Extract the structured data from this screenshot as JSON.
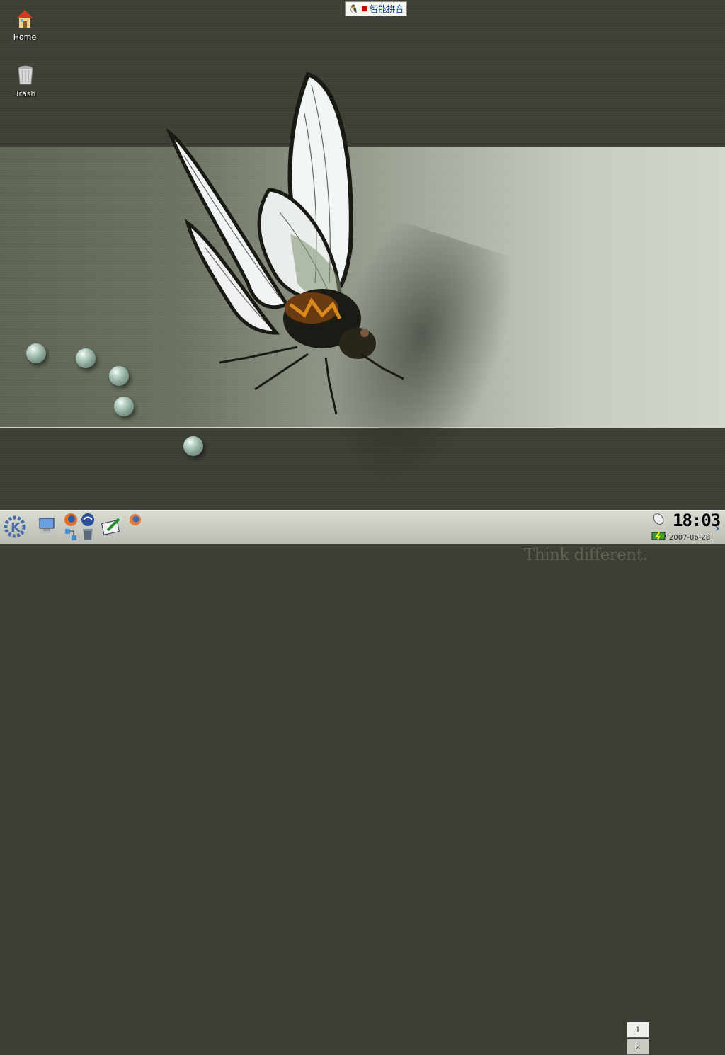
{
  "desktop": {
    "icons": [
      {
        "label": "Home"
      },
      {
        "label": "Trash"
      }
    ],
    "tagline": "Think different."
  },
  "ime": {
    "label": "智能拼音"
  },
  "taskbar": {
    "pager": [
      "1",
      "2"
    ],
    "clock": "18:03",
    "date": "2007-06-28",
    "more_arrow": "›"
  }
}
